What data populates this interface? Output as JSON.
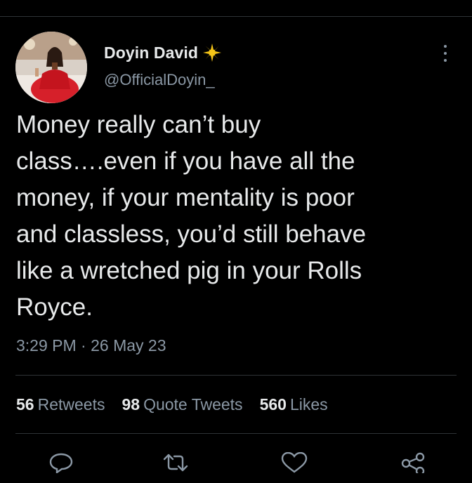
{
  "tweet": {
    "author": {
      "display_name": "Doyin David",
      "handle": "@OfficialDoyin_",
      "badge_icon": "sun-badge-icon",
      "badge_color": "#f5c518"
    },
    "text": "Money really can’t buy\nclass….even if you have all the\nmoney, if your mentality is poor\nand classless, you’d still behave\nlike a wretched pig in your Rolls\nRoyce.",
    "timestamp": "3:29 PM · 26 May 23",
    "stats": {
      "retweets_count": "56",
      "retweets_label": "Retweets",
      "quotes_count": "98",
      "quotes_label": "Quote Tweets",
      "likes_count": "560",
      "likes_label": "Likes"
    },
    "actions": [
      "reply-icon",
      "retweet-icon",
      "like-icon",
      "share-icon"
    ]
  },
  "colors": {
    "background": "#000000",
    "text_primary": "#e7e9ea",
    "text_secondary": "#8b98a5",
    "divider": "#2f3336"
  }
}
